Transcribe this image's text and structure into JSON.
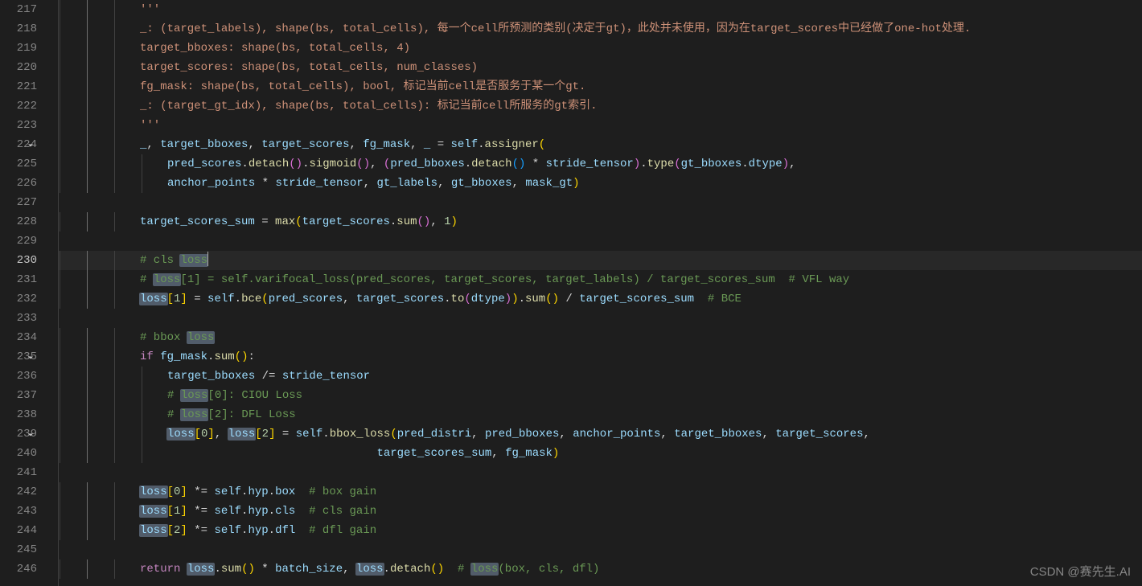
{
  "watermark": "CSDN @赛先生.AI",
  "current_line": 230,
  "highlight_term": "loss",
  "gutter": {
    "start": 217,
    "end": 246,
    "fold_lines": [
      224,
      235,
      239
    ]
  },
  "code_lines": [
    {
      "n": 217,
      "indent": 3,
      "tokens": [
        [
          "str",
          "'''"
        ]
      ]
    },
    {
      "n": 218,
      "indent": 3,
      "tokens": [
        [
          "str",
          "_: (target_labels), shape(bs, total_cells), 每一个cell所预测的类别(决定于gt)，此处并未使用，因为在target_scores中已经做了one-hot处理."
        ]
      ]
    },
    {
      "n": 219,
      "indent": 3,
      "tokens": [
        [
          "str",
          "target_bboxes: shape(bs, total_cells, 4)"
        ]
      ]
    },
    {
      "n": 220,
      "indent": 3,
      "tokens": [
        [
          "str",
          "target_scores: shape(bs, total_cells, num_classes)"
        ]
      ]
    },
    {
      "n": 221,
      "indent": 3,
      "tokens": [
        [
          "str",
          "fg_mask: shape(bs, total_cells), bool, 标记当前cell是否服务于某一个gt."
        ]
      ]
    },
    {
      "n": 222,
      "indent": 3,
      "tokens": [
        [
          "str",
          "_: (target_gt_idx), shape(bs, total_cells): 标记当前cell所服务的gt索引."
        ]
      ]
    },
    {
      "n": 223,
      "indent": 3,
      "tokens": [
        [
          "str",
          "'''"
        ]
      ]
    },
    {
      "n": 224,
      "indent": 3,
      "tokens": [
        [
          "var",
          "_"
        ],
        [
          "op",
          ", "
        ],
        [
          "var",
          "target_bboxes"
        ],
        [
          "op",
          ", "
        ],
        [
          "var",
          "target_scores"
        ],
        [
          "op",
          ", "
        ],
        [
          "var",
          "fg_mask"
        ],
        [
          "op",
          ", "
        ],
        [
          "var",
          "_"
        ],
        [
          "op",
          " = "
        ],
        [
          "self",
          "self"
        ],
        [
          "op",
          "."
        ],
        [
          "fn",
          "assigner"
        ],
        [
          "par",
          "("
        ]
      ]
    },
    {
      "n": 225,
      "indent": 4,
      "tokens": [
        [
          "var",
          "pred_scores"
        ],
        [
          "op",
          "."
        ],
        [
          "fn",
          "detach"
        ],
        [
          "par2",
          "("
        ],
        [
          "par2",
          ")"
        ],
        [
          "op",
          "."
        ],
        [
          "fn",
          "sigmoid"
        ],
        [
          "par2",
          "("
        ],
        [
          "par2",
          ")"
        ],
        [
          "op",
          ", "
        ],
        [
          "par2",
          "("
        ],
        [
          "var",
          "pred_bboxes"
        ],
        [
          "op",
          "."
        ],
        [
          "fn",
          "detach"
        ],
        [
          "par3",
          "("
        ],
        [
          "par3",
          ")"
        ],
        [
          "op",
          " * "
        ],
        [
          "var",
          "stride_tensor"
        ],
        [
          "par2",
          ")"
        ],
        [
          "op",
          "."
        ],
        [
          "fn",
          "type"
        ],
        [
          "par2",
          "("
        ],
        [
          "var",
          "gt_bboxes"
        ],
        [
          "op",
          "."
        ],
        [
          "var",
          "dtype"
        ],
        [
          "par2",
          ")"
        ],
        [
          "op",
          ","
        ]
      ]
    },
    {
      "n": 226,
      "indent": 4,
      "tokens": [
        [
          "var",
          "anchor_points"
        ],
        [
          "op",
          " * "
        ],
        [
          "var",
          "stride_tensor"
        ],
        [
          "op",
          ", "
        ],
        [
          "var",
          "gt_labels"
        ],
        [
          "op",
          ", "
        ],
        [
          "var",
          "gt_bboxes"
        ],
        [
          "op",
          ", "
        ],
        [
          "var",
          "mask_gt"
        ],
        [
          "par",
          ")"
        ]
      ]
    },
    {
      "n": 227,
      "indent": 0,
      "tokens": []
    },
    {
      "n": 228,
      "indent": 3,
      "tokens": [
        [
          "var",
          "target_scores_sum"
        ],
        [
          "op",
          " = "
        ],
        [
          "fn",
          "max"
        ],
        [
          "par",
          "("
        ],
        [
          "var",
          "target_scores"
        ],
        [
          "op",
          "."
        ],
        [
          "fn",
          "sum"
        ],
        [
          "par2",
          "("
        ],
        [
          "par2",
          ")"
        ],
        [
          "op",
          ", "
        ],
        [
          "num",
          "1"
        ],
        [
          "par",
          ")"
        ]
      ]
    },
    {
      "n": 229,
      "indent": 0,
      "tokens": []
    },
    {
      "n": 230,
      "indent": 3,
      "current": true,
      "tokens": [
        [
          "cmt",
          "# cls "
        ],
        [
          "cmt_hl",
          "loss"
        ],
        [
          "cursor",
          ""
        ]
      ]
    },
    {
      "n": 231,
      "indent": 3,
      "tokens": [
        [
          "cmt",
          "# "
        ],
        [
          "cmt_hl",
          "loss"
        ],
        [
          "cmt",
          "[1] = self.varifocal_loss(pred_scores, target_scores, target_labels) / target_scores_sum  # VFL way"
        ]
      ]
    },
    {
      "n": 232,
      "indent": 3,
      "tokens": [
        [
          "var_hl",
          "loss"
        ],
        [
          "par",
          "["
        ],
        [
          "num",
          "1"
        ],
        [
          "par",
          "]"
        ],
        [
          "op",
          " = "
        ],
        [
          "self",
          "self"
        ],
        [
          "op",
          "."
        ],
        [
          "fn",
          "bce"
        ],
        [
          "par",
          "("
        ],
        [
          "var",
          "pred_scores"
        ],
        [
          "op",
          ", "
        ],
        [
          "var",
          "target_scores"
        ],
        [
          "op",
          "."
        ],
        [
          "fn",
          "to"
        ],
        [
          "par2",
          "("
        ],
        [
          "var",
          "dtype"
        ],
        [
          "par2",
          ")"
        ],
        [
          "par",
          ")"
        ],
        [
          "op",
          "."
        ],
        [
          "fn",
          "sum"
        ],
        [
          "par",
          "("
        ],
        [
          "par",
          ")"
        ],
        [
          "op",
          " / "
        ],
        [
          "var",
          "target_scores_sum"
        ],
        [
          "op",
          "  "
        ],
        [
          "cmt",
          "# BCE"
        ]
      ]
    },
    {
      "n": 233,
      "indent": 0,
      "tokens": []
    },
    {
      "n": 234,
      "indent": 3,
      "tokens": [
        [
          "cmt",
          "# bbox "
        ],
        [
          "cmt_hl",
          "loss"
        ]
      ]
    },
    {
      "n": 235,
      "indent": 3,
      "tokens": [
        [
          "kw",
          "if"
        ],
        [
          "op",
          " "
        ],
        [
          "var",
          "fg_mask"
        ],
        [
          "op",
          "."
        ],
        [
          "fn",
          "sum"
        ],
        [
          "par",
          "("
        ],
        [
          "par",
          ")"
        ],
        [
          "op",
          ":"
        ]
      ]
    },
    {
      "n": 236,
      "indent": 4,
      "tokens": [
        [
          "var",
          "target_bboxes"
        ],
        [
          "op",
          " /= "
        ],
        [
          "var",
          "stride_tensor"
        ]
      ]
    },
    {
      "n": 237,
      "indent": 4,
      "tokens": [
        [
          "cmt",
          "# "
        ],
        [
          "cmt_hl",
          "loss"
        ],
        [
          "cmt",
          "[0]: CIOU Loss "
        ]
      ]
    },
    {
      "n": 238,
      "indent": 4,
      "tokens": [
        [
          "cmt",
          "# "
        ],
        [
          "cmt_hl",
          "loss"
        ],
        [
          "cmt",
          "[2]: DFL Loss "
        ]
      ]
    },
    {
      "n": 239,
      "indent": 4,
      "tokens": [
        [
          "var_hl",
          "loss"
        ],
        [
          "par",
          "["
        ],
        [
          "num",
          "0"
        ],
        [
          "par",
          "]"
        ],
        [
          "op",
          ", "
        ],
        [
          "var_hl",
          "loss"
        ],
        [
          "par",
          "["
        ],
        [
          "num",
          "2"
        ],
        [
          "par",
          "]"
        ],
        [
          "op",
          " = "
        ],
        [
          "self",
          "self"
        ],
        [
          "op",
          "."
        ],
        [
          "fn",
          "bbox_loss"
        ],
        [
          "par",
          "("
        ],
        [
          "var",
          "pred_distri"
        ],
        [
          "op",
          ", "
        ],
        [
          "var",
          "pred_bboxes"
        ],
        [
          "op",
          ", "
        ],
        [
          "var",
          "anchor_points"
        ],
        [
          "op",
          ", "
        ],
        [
          "var",
          "target_bboxes"
        ],
        [
          "op",
          ", "
        ],
        [
          "var",
          "target_scores"
        ],
        [
          "op",
          ","
        ]
      ]
    },
    {
      "n": 240,
      "indent": 4,
      "tokens": [
        [
          "op",
          "                               "
        ],
        [
          "var",
          "target_scores_sum"
        ],
        [
          "op",
          ", "
        ],
        [
          "var",
          "fg_mask"
        ],
        [
          "par",
          ")"
        ]
      ]
    },
    {
      "n": 241,
      "indent": 0,
      "tokens": []
    },
    {
      "n": 242,
      "indent": 3,
      "tokens": [
        [
          "var_hl",
          "loss"
        ],
        [
          "par",
          "["
        ],
        [
          "num",
          "0"
        ],
        [
          "par",
          "]"
        ],
        [
          "op",
          " *= "
        ],
        [
          "self",
          "self"
        ],
        [
          "op",
          "."
        ],
        [
          "var",
          "hyp"
        ],
        [
          "op",
          "."
        ],
        [
          "var",
          "box"
        ],
        [
          "op",
          "  "
        ],
        [
          "cmt",
          "# box gain"
        ]
      ]
    },
    {
      "n": 243,
      "indent": 3,
      "tokens": [
        [
          "var_hl",
          "loss"
        ],
        [
          "par",
          "["
        ],
        [
          "num",
          "1"
        ],
        [
          "par",
          "]"
        ],
        [
          "op",
          " *= "
        ],
        [
          "self",
          "self"
        ],
        [
          "op",
          "."
        ],
        [
          "var",
          "hyp"
        ],
        [
          "op",
          "."
        ],
        [
          "var",
          "cls"
        ],
        [
          "op",
          "  "
        ],
        [
          "cmt",
          "# cls gain"
        ]
      ]
    },
    {
      "n": 244,
      "indent": 3,
      "tokens": [
        [
          "var_hl",
          "loss"
        ],
        [
          "par",
          "["
        ],
        [
          "num",
          "2"
        ],
        [
          "par",
          "]"
        ],
        [
          "op",
          " *= "
        ],
        [
          "self",
          "self"
        ],
        [
          "op",
          "."
        ],
        [
          "var",
          "hyp"
        ],
        [
          "op",
          "."
        ],
        [
          "var",
          "dfl"
        ],
        [
          "op",
          "  "
        ],
        [
          "cmt",
          "# dfl gain"
        ]
      ]
    },
    {
      "n": 245,
      "indent": 0,
      "tokens": []
    },
    {
      "n": 246,
      "indent": 3,
      "tokens": [
        [
          "kw",
          "return"
        ],
        [
          "op",
          " "
        ],
        [
          "var_hl",
          "loss"
        ],
        [
          "op",
          "."
        ],
        [
          "fn",
          "sum"
        ],
        [
          "par",
          "("
        ],
        [
          "par",
          ")"
        ],
        [
          "op",
          " * "
        ],
        [
          "var",
          "batch_size"
        ],
        [
          "op",
          ", "
        ],
        [
          "var_hl",
          "loss"
        ],
        [
          "op",
          "."
        ],
        [
          "fn",
          "detach"
        ],
        [
          "par",
          "("
        ],
        [
          "par",
          ")"
        ],
        [
          "op",
          "  "
        ],
        [
          "cmt",
          "# "
        ],
        [
          "cmt_hl",
          "loss"
        ],
        [
          "cmt",
          "(box, cls, dfl)"
        ]
      ]
    }
  ]
}
